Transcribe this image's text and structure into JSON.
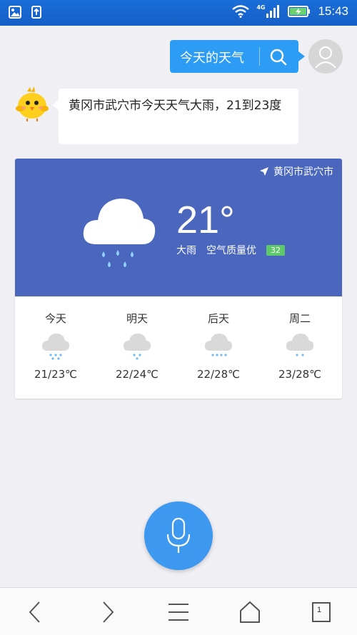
{
  "status_bar": {
    "time": "15:43",
    "network": "4G",
    "icons": [
      "gallery-icon",
      "upload-icon",
      "wifi-icon",
      "signal-icon",
      "battery-charging-icon"
    ]
  },
  "user_message": {
    "text": "今天的天气",
    "search_icon": "search-icon"
  },
  "bot_message": {
    "text": "黄冈市武穴市今天天气大雨，21到23度"
  },
  "weather_card": {
    "location": "黄冈市武穴市",
    "temperature": "21°",
    "condition": "大雨",
    "air_quality_label": "空气质量优",
    "aqi": "32",
    "forecast": [
      {
        "day": "今天",
        "range": "21/23℃",
        "icon": "rain-cloud-icon"
      },
      {
        "day": "明天",
        "range": "22/24℃",
        "icon": "rain-cloud-icon"
      },
      {
        "day": "后天",
        "range": "22/28℃",
        "icon": "rain-cloud-icon"
      },
      {
        "day": "周二",
        "range": "23/28℃",
        "icon": "rain-cloud-icon"
      }
    ]
  },
  "bottom_nav": {
    "tab_count": "1",
    "items": [
      "back-icon",
      "forward-icon",
      "menu-icon",
      "home-icon",
      "tabs-icon"
    ]
  },
  "colors": {
    "status_bar": "#155fc6",
    "accent": "#2d9cf4",
    "card_header": "#4a66bd",
    "aqi_good": "#5ec96a",
    "mic": "#3d98f0"
  }
}
